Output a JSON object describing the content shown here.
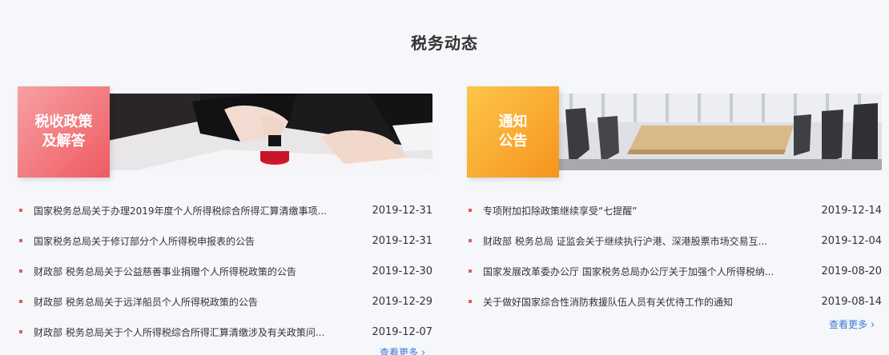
{
  "section": {
    "title": "税务动态"
  },
  "panels": [
    {
      "tag": "税收政策\n及解答",
      "more": "查看更多",
      "items": [
        {
          "title": "国家税务总局关于办理2019年度个人所得税综合所得汇算清缴事项...",
          "date": "2019-12-31"
        },
        {
          "title": "国家税务总局关于修订部分个人所得税申报表的公告",
          "date": "2019-12-31"
        },
        {
          "title": "财政部 税务总局关于公益慈善事业捐赠个人所得税政策的公告",
          "date": "2019-12-30"
        },
        {
          "title": "财政部 税务总局关于远洋船员个人所得税政策的公告",
          "date": "2019-12-29"
        },
        {
          "title": "财政部 税务总局关于个人所得税综合所得汇算清缴涉及有关政策问...",
          "date": "2019-12-07"
        }
      ]
    },
    {
      "tag": "通知\n公告",
      "more": "查看更多",
      "items": [
        {
          "title": "专项附加扣除政策继续享受“七提醒”",
          "date": "2019-12-14"
        },
        {
          "title": "财政部 税务总局 证监会关于继续执行沪港、深港股票市场交易互...",
          "date": "2019-12-04"
        },
        {
          "title": "国家发展改革委办公厅 国家税务总局办公厅关于加强个人所得税纳...",
          "date": "2019-08-20"
        },
        {
          "title": "关于做好国家综合性消防救援队伍人员有关优待工作的通知",
          "date": "2019-08-14"
        }
      ]
    }
  ],
  "colors": {
    "accent_red": "#ee5b61",
    "accent_orange": "#f7941d",
    "link_blue": "#3a7bd5",
    "bullet": "#e15a5a"
  }
}
